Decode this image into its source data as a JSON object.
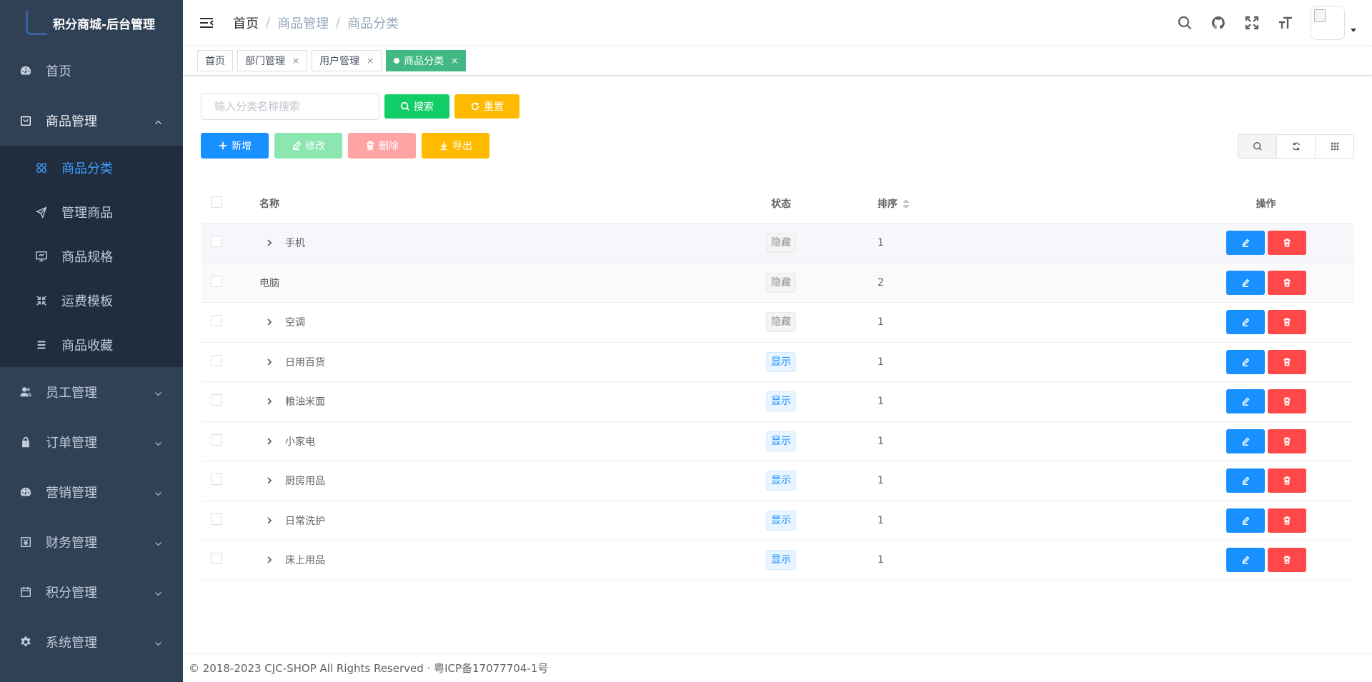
{
  "sidebar": {
    "logo_text": "积分商城-后台管理",
    "menu": [
      {
        "label": "首页",
        "icon": "dashboard-icon"
      },
      {
        "label": "商品管理",
        "icon": "shop-icon",
        "open": true
      },
      {
        "label": "员工管理",
        "icon": "peoples-icon"
      },
      {
        "label": "订单管理",
        "icon": "lock-icon"
      },
      {
        "label": "营销管理",
        "icon": "dashboard-icon"
      },
      {
        "label": "财务管理",
        "icon": "money-icon"
      },
      {
        "label": "积分管理",
        "icon": "calendar-icon"
      },
      {
        "label": "系统管理",
        "icon": "gear-icon"
      }
    ],
    "submenu": [
      {
        "label": "商品分类",
        "icon": "category-icon",
        "active": true
      },
      {
        "label": "管理商品",
        "icon": "send-icon"
      },
      {
        "label": "商品规格",
        "icon": "monitor-icon"
      },
      {
        "label": "运费模板",
        "icon": "shrink-icon"
      },
      {
        "label": "商品收藏",
        "icon": "list-icon"
      }
    ]
  },
  "breadcrumb": [
    "首页",
    "商品管理",
    "商品分类"
  ],
  "tags": [
    {
      "label": "首页",
      "closable": false
    },
    {
      "label": "部门管理",
      "closable": true
    },
    {
      "label": "用户管理",
      "closable": true
    },
    {
      "label": "商品分类",
      "closable": true,
      "active": true
    }
  ],
  "tag_close": "×",
  "search": {
    "placeholder": "输入分类名称搜索",
    "search_label": "搜索",
    "reset_label": "重置"
  },
  "toolbar": {
    "add_label": "新增",
    "edit_label": "修改",
    "delete_label": "删除",
    "export_label": "导出"
  },
  "table": {
    "headers": {
      "name": "名称",
      "status": "状态",
      "sort": "排序",
      "ops": "操作"
    },
    "rows": [
      {
        "name": "手机",
        "expandable": true,
        "status": "隐藏",
        "sort": "1"
      },
      {
        "name": "电脑",
        "expandable": false,
        "status": "隐藏",
        "sort": "2"
      },
      {
        "name": "空调",
        "expandable": true,
        "status": "隐藏",
        "sort": "1"
      },
      {
        "name": "日用百货",
        "expandable": true,
        "status": "显示",
        "sort": "1"
      },
      {
        "name": "粮油米面",
        "expandable": true,
        "status": "显示",
        "sort": "1"
      },
      {
        "name": "小家电",
        "expandable": true,
        "status": "显示",
        "sort": "1"
      },
      {
        "name": "厨房用品",
        "expandable": true,
        "status": "显示",
        "sort": "1"
      },
      {
        "name": "日常洗护",
        "expandable": true,
        "status": "显示",
        "sort": "1"
      },
      {
        "name": "床上用品",
        "expandable": true,
        "status": "显示",
        "sort": "1"
      }
    ]
  },
  "footer": "© 2018-2023 CJC-SHOP All Rights Reserved · 粤ICP备17077704-1号",
  "colors": {
    "sidebar_bg": "#304156",
    "submenu_bg": "#1f2d3d",
    "active": "#409eff",
    "primary": "#1890ff",
    "success": "#13ce66",
    "warning": "#ffba00",
    "danger": "#ff4949",
    "tag_active": "#42b983"
  }
}
